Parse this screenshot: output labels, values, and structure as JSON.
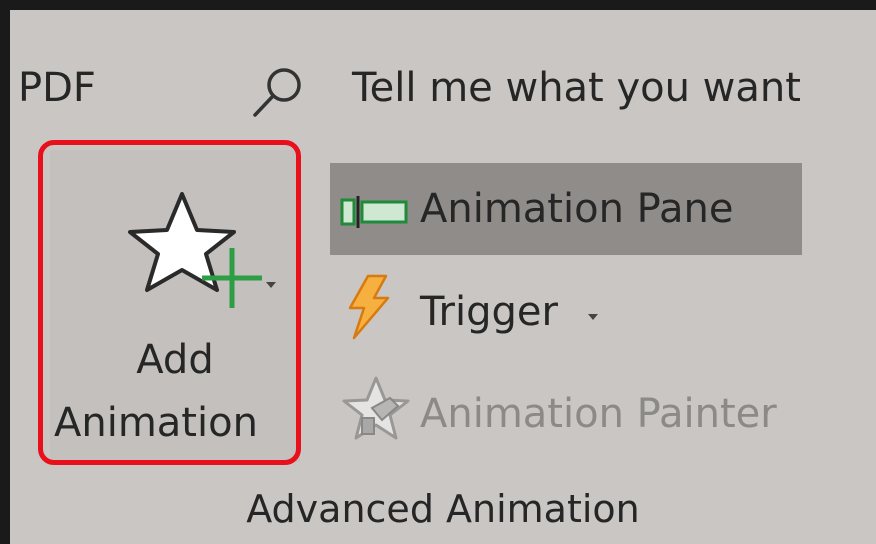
{
  "ribbon": {
    "pdf_tab_label": "PDF",
    "tell_me_placeholder": "Tell me what you want"
  },
  "advanced_animation": {
    "group_label": "Advanced Animation",
    "add_animation": {
      "line1": "Add",
      "line2": "Animation",
      "icon": "star-add-icon",
      "highlighted": true
    },
    "animation_pane": {
      "label": "Animation Pane",
      "icon": "animation-pane-icon",
      "active": true
    },
    "trigger": {
      "label": "Trigger",
      "icon": "lightning-icon"
    },
    "animation_painter": {
      "label": "Animation Painter",
      "icon": "painter-star-icon",
      "disabled": true
    }
  },
  "colors": {
    "ribbon_bg": "#c9c6c3",
    "highlight_border": "#e8101a",
    "pane_active_bg": "#8f8c8a",
    "disabled_text": "#8c8a88",
    "accent_green": "#2e9e45",
    "trigger_orange": "#f0a020"
  }
}
